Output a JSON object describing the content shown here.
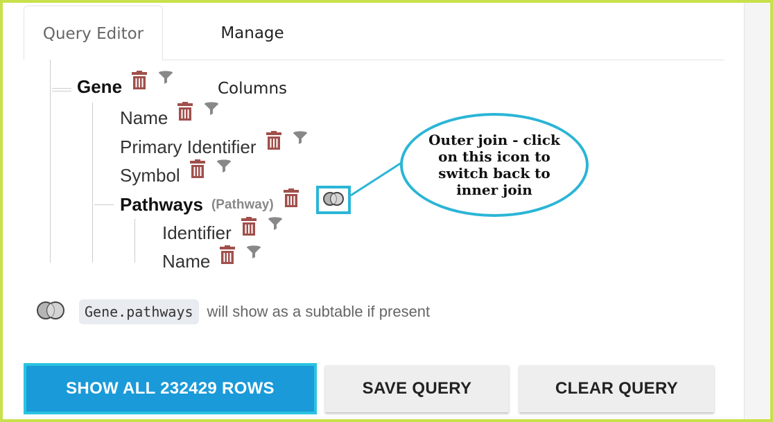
{
  "tabs": [
    {
      "label": "Query Editor",
      "active": true
    },
    {
      "label": "Manage Columns",
      "active": false
    }
  ],
  "tree": {
    "root": {
      "label": "Gene"
    },
    "fields": [
      {
        "label": "Name"
      },
      {
        "label": "Primary Identifier"
      },
      {
        "label": "Symbol"
      }
    ],
    "join": {
      "label": "Pathways",
      "type": "(Pathway)",
      "fields": [
        {
          "label": "Identifier"
        },
        {
          "label": "Name"
        }
      ]
    }
  },
  "callout": {
    "text": "Outer join - click on this icon to switch back to inner join"
  },
  "info": {
    "code": "Gene.pathways",
    "text": "will show as a subtable if present"
  },
  "buttons": {
    "show_all": "SHOW ALL 232429 ROWS",
    "save": "SAVE QUERY",
    "clear": "CLEAR QUERY"
  },
  "colors": {
    "trash": "#a0504c",
    "funnel": "#888888",
    "highlight": "#2bb5d6",
    "primary": "#1a9ad9",
    "frame": "#c8e04a"
  },
  "icons": {
    "delete": "trash-icon",
    "filter": "filter-icon",
    "join": "outer-join-icon"
  }
}
